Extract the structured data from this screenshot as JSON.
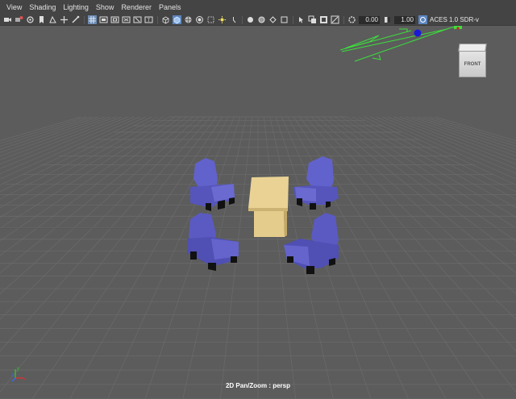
{
  "menu": [
    "View",
    "Shading",
    "Lighting",
    "Show",
    "Renderer",
    "Panels"
  ],
  "toolbar": {
    "exposure_value": "0.00",
    "gamma_value": "1.00",
    "color_space": "ACES 1.0 SDR-v",
    "icons": [
      "camera-icon",
      "camera-attr-icon",
      "bookmark-icon",
      "image-plane-icon",
      "grid-icon",
      "film-gate-icon",
      "resolution-gate-icon",
      "gate-mask-icon",
      "field-chart-icon",
      "safe-action-icon",
      "safe-title-icon",
      "wireframe-icon",
      "smooth-shade-icon",
      "default-material-icon",
      "textured-icon",
      "lights-icon",
      "shadows-icon",
      "ambient-occlusion-icon",
      "motion-blur-icon",
      "anti-alias-icon",
      "isolate-icon",
      "xray-icon",
      "xray-joints-icon",
      "backface-icon",
      "exposure-icon",
      "gamma-icon",
      "color-management-icon"
    ]
  },
  "viewport": {
    "camera_label": "2D Pan/Zoom : persp",
    "viewcube_label": "FRONT",
    "axis_labels": {
      "x": "x",
      "y": "y",
      "z": "z"
    }
  },
  "colors": {
    "background": "#5c5c5c",
    "grid": "#6c6c6c",
    "chair": "#5a5ac2",
    "table": "#e6cf90",
    "light": "#3ce03c"
  }
}
